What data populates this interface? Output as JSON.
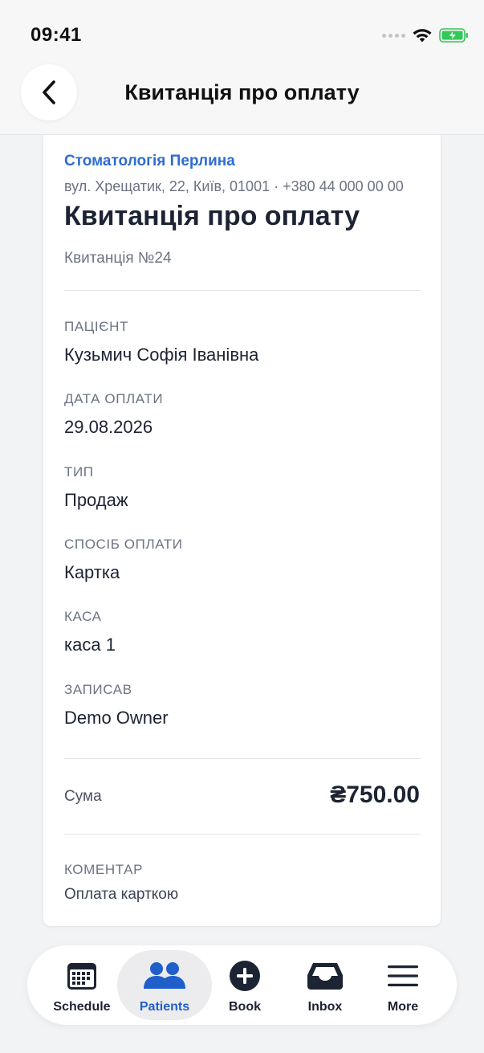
{
  "status_bar": {
    "time": "09:41"
  },
  "header": {
    "title": "Квитанція про оплату"
  },
  "receipt": {
    "clinic_name": "Стоматологія Перлина",
    "clinic_address": "вул. Хрещатик, 22, Київ, 01001 · +380 44 000 00 00",
    "title": "Квитанція про оплату",
    "number": "Квитанція №24",
    "fields": [
      {
        "label": "ПАЦІЄНТ",
        "value": "Кузьмич Софія Іванівна"
      },
      {
        "label": "ДАТА ОПЛАТИ",
        "value": "29.08.2026"
      },
      {
        "label": "ТИП",
        "value": "Продаж"
      },
      {
        "label": "СПОСІБ ОПЛАТИ",
        "value": "Картка"
      },
      {
        "label": "КАСА",
        "value": "каса 1"
      },
      {
        "label": "ЗАПИСАВ",
        "value": "Demo Owner"
      }
    ],
    "sum_label": "Сума",
    "sum_value": "₴750.00",
    "comment_label": "КОМЕНТАР",
    "comment_value": "Оплата карткою"
  },
  "tabs": [
    {
      "label": "Schedule",
      "icon": "calendar-icon",
      "active": false
    },
    {
      "label": "Patients",
      "icon": "people-icon",
      "active": true
    },
    {
      "label": "Book",
      "icon": "plus-circle-icon",
      "active": false
    },
    {
      "label": "Inbox",
      "icon": "inbox-icon",
      "active": false
    },
    {
      "label": "More",
      "icon": "menu-icon",
      "active": false
    }
  ],
  "colors": {
    "accent": "#1f5fc9",
    "clinic_link": "#2f6ccf",
    "battery": "#34c759"
  }
}
